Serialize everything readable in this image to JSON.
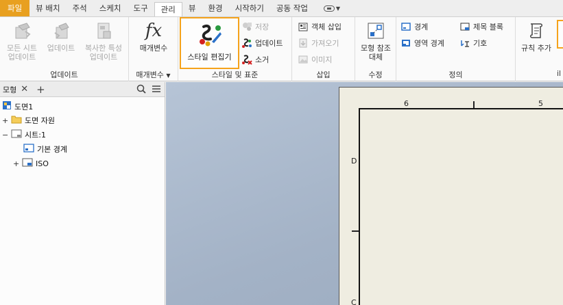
{
  "menubar": {
    "tabs": [
      "파일",
      "뷰 배치",
      "주석",
      "스케치",
      "도구",
      "관리",
      "뷰",
      "환경",
      "시작하기",
      "공동 작업"
    ],
    "active_tab": "관리"
  },
  "ribbon": {
    "update_group": {
      "label": "업데이트",
      "update_all_sheets_line1": "모든 시트",
      "update_all_sheets_line2": "업데이트",
      "update_line1": "업데이트",
      "update_copied_props_line1": "복사한 특성",
      "update_copied_props_line2": "업데이트"
    },
    "params_group": {
      "label": "매개변수",
      "parameters": "매개변수"
    },
    "styles_group": {
      "label": "스타일 및 표준",
      "style_editor": "스타일 편집기",
      "save": "저장",
      "update": "업데이트",
      "purge": "소거"
    },
    "insert_group": {
      "label": "삽입",
      "insert_object": "객체 삽입",
      "import": "가져오기",
      "image": "이미지"
    },
    "modify_group": {
      "label": "수정",
      "replace_model_ref_line1": "모형 참조",
      "replace_model_ref_line2": "대체"
    },
    "define_group": {
      "label": "정의",
      "border": "경계",
      "zone_border": "영역 경계",
      "title_block": "제목 블록",
      "symbol": "기호"
    },
    "rules_group": {
      "add_rule": "규칙 추가",
      "partial_label": "il"
    }
  },
  "panel": {
    "tab_label": "모형",
    "tree": {
      "drawing": "도면1",
      "resources": "도면 자원",
      "sheet": "시트:1",
      "default_border": "기본 경계",
      "iso": "ISO"
    }
  },
  "canvas": {
    "zone_cols": [
      "6",
      "5"
    ],
    "zone_rows": [
      "D",
      "C"
    ]
  },
  "colors": {
    "file_tab": "#e8a020",
    "highlight": "#f5a21a",
    "sheet": "#efede1"
  }
}
